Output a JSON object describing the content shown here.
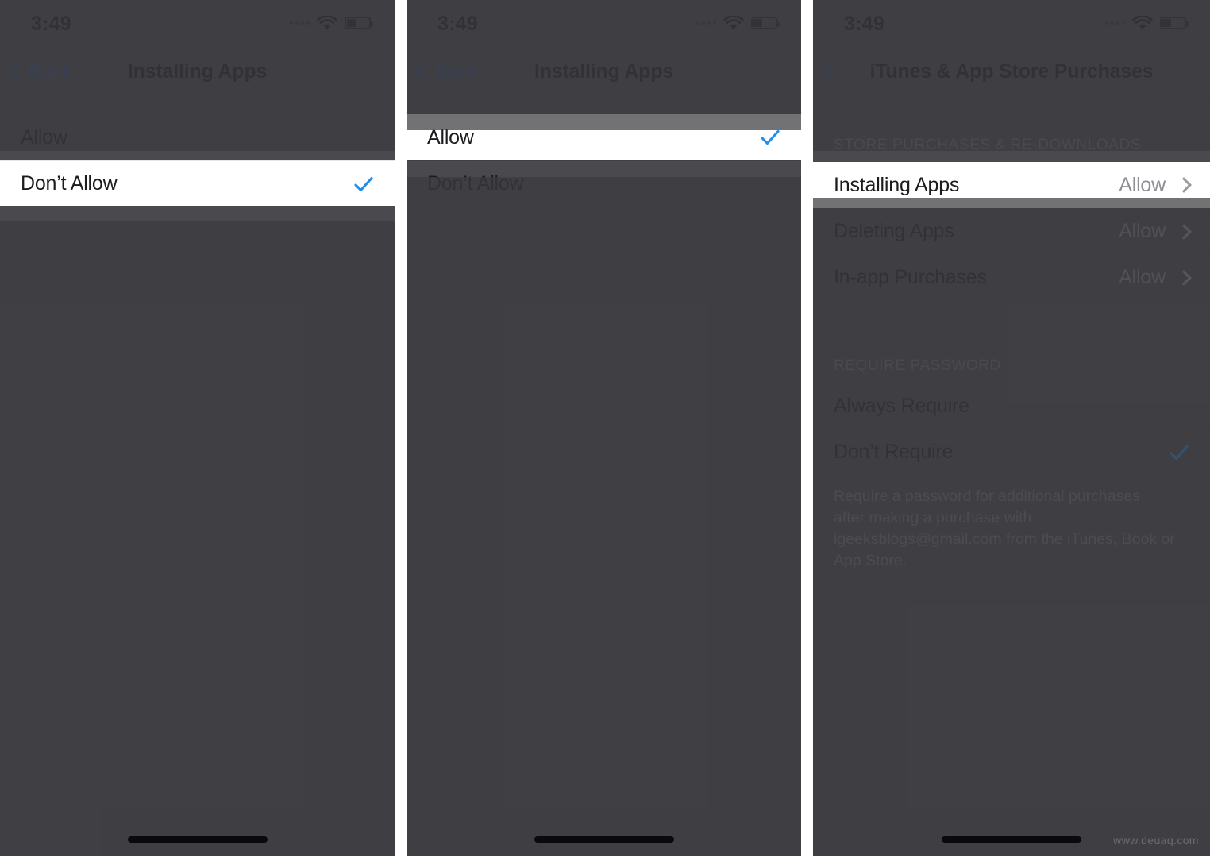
{
  "status_bar": {
    "time": "3:49",
    "signal_icon": "signal-dots-icon",
    "wifi_icon": "wifi-icon",
    "battery_icon": "battery-low-icon"
  },
  "panel_1": {
    "nav": {
      "back_label": "Back",
      "back_icon": "chevron-left-icon",
      "title": "Installing Apps"
    },
    "rows": [
      {
        "label": "Allow",
        "selected": false,
        "highlighted": false
      },
      {
        "label": "Don’t Allow",
        "selected": true,
        "highlighted": true
      }
    ],
    "check_icon": "checkmark-icon"
  },
  "panel_2": {
    "nav": {
      "back_label": "Back",
      "back_icon": "chevron-left-icon",
      "title": "Installing Apps"
    },
    "rows": [
      {
        "label": "Allow",
        "selected": true,
        "highlighted": true
      },
      {
        "label": "Don’t Allow",
        "selected": false,
        "highlighted": false
      }
    ],
    "check_icon": "checkmark-icon"
  },
  "panel_3": {
    "nav": {
      "back_label": "",
      "back_icon": "chevron-left-icon",
      "title": "iTunes & App Store Purchases"
    },
    "section_1": {
      "header": "STORE PURCHASES & RE-DOWNLOADS",
      "rows": [
        {
          "label": "Installing Apps",
          "value": "Allow",
          "highlighted": true
        },
        {
          "label": "Deleting Apps",
          "value": "Allow",
          "highlighted": false
        },
        {
          "label": "In-app Purchases",
          "value": "Allow",
          "highlighted": false
        }
      ]
    },
    "section_2": {
      "header": "REQUIRE PASSWORD",
      "rows": [
        {
          "label": "Always Require",
          "selected": false
        },
        {
          "label": "Don’t Require",
          "selected": true
        }
      ],
      "footnote": "Require a password for additional purchases after making a purchase with igeeksblogs@gmail.com from the iTunes, Book or App Store."
    },
    "chevron_icon": "chevron-right-icon",
    "check_icon": "checkmark-icon"
  },
  "colors": {
    "accent_blue": "#0a84ff",
    "dim_overlay": "#4a494e",
    "highlight_bg": "#ffffff",
    "value_gray": "#8a8a8e"
  },
  "watermark": "www.deuaq.com"
}
